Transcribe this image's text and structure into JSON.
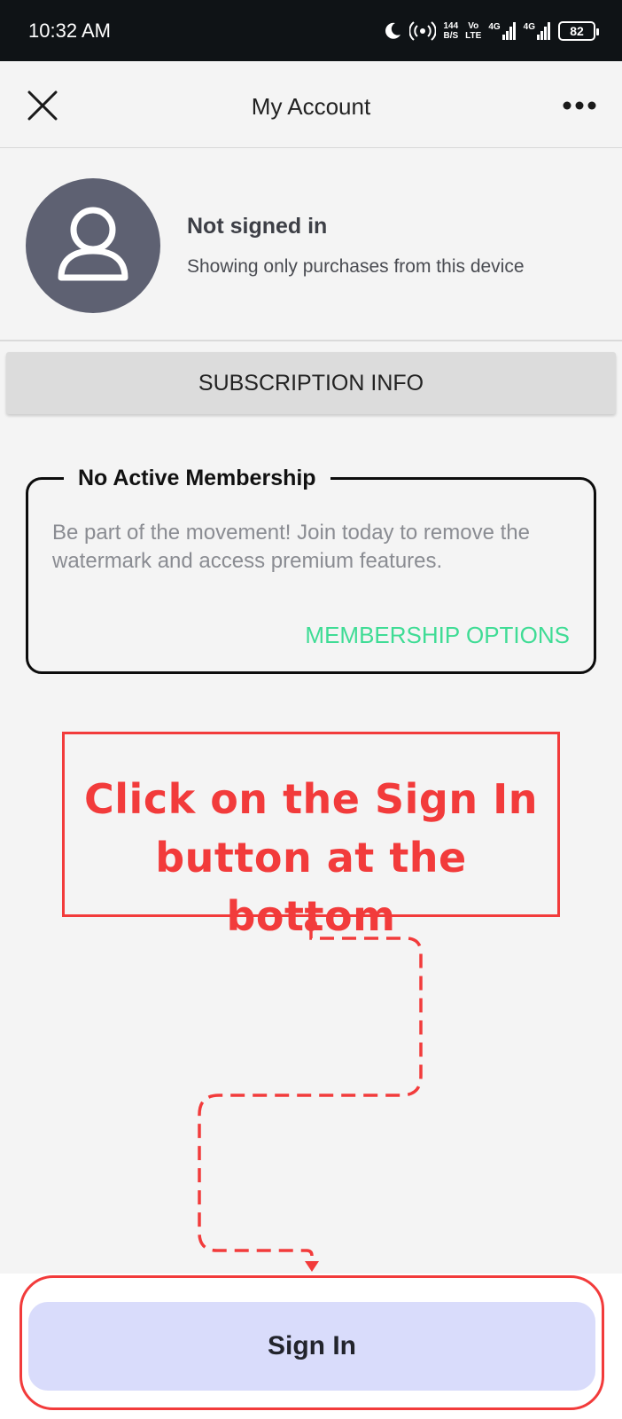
{
  "status_bar": {
    "time": "10:32 AM",
    "net_speed_value": "144",
    "net_speed_unit": "B/S",
    "volte_top": "Vo",
    "volte_bottom": "LTE",
    "sim1_network": "4G",
    "sim2_network": "4G",
    "battery": "82"
  },
  "header": {
    "title": "My Account",
    "close_icon": "close-icon",
    "more_icon": "more-horizontal-icon"
  },
  "profile": {
    "avatar_icon": "user-icon",
    "name": "Not signed in",
    "subtitle": "Showing only purchases from this device"
  },
  "subscription": {
    "button_label": "SUBSCRIPTION INFO"
  },
  "membership": {
    "title": "No Active Membership",
    "description": "Be part of the movement! Join today to remove the watermark and access premium features.",
    "options_label": "MEMBERSHIP OPTIONS",
    "accent_color": "#3fdc95"
  },
  "annotation": {
    "text": "Click on the Sign In button at the bottom",
    "color": "#f23b3b"
  },
  "footer": {
    "signin_label": "Sign In",
    "button_color": "#d9dcfb"
  }
}
